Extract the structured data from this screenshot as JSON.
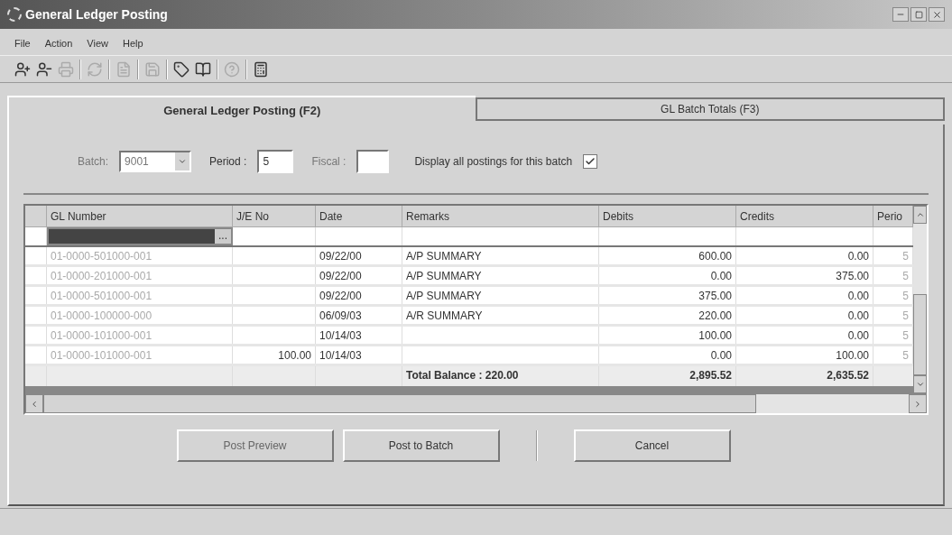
{
  "window": {
    "title": "General Ledger Posting"
  },
  "menu": [
    "File",
    "Action",
    "View",
    "Help"
  ],
  "tabs": [
    {
      "label": "General Ledger Posting (F2)",
      "selected": true
    },
    {
      "label": "GL Batch Totals (F3)",
      "selected": false
    }
  ],
  "filters": {
    "batch_label": "Batch:",
    "batch_value": "9001",
    "batch_disabled": true,
    "period_label": "Period :",
    "period_value": "5",
    "fiscal_label": "Fiscal :",
    "display_all_label": "Display all postings for this batch",
    "display_all_checked": true
  },
  "table": {
    "columns": [
      "GL Number",
      "J/E No",
      "Date",
      "Remarks",
      "Debits",
      "Credits",
      "Perio"
    ],
    "edit_button": "...",
    "rows": [
      {
        "gl": "01-0000-501000-001",
        "je": "",
        "date": "09/22/00",
        "remarks": "A/P SUMMARY",
        "debits": "600.00",
        "credits": "0.00",
        "period": "5"
      },
      {
        "gl": "01-0000-201000-001",
        "je": "",
        "date": "09/22/00",
        "remarks": "A/P SUMMARY",
        "debits": "0.00",
        "credits": "375.00",
        "period": "5"
      },
      {
        "gl": "01-0000-501000-001",
        "je": "",
        "date": "09/22/00",
        "remarks": "A/P SUMMARY",
        "debits": "375.00",
        "credits": "0.00",
        "period": "5"
      },
      {
        "gl": "01-0000-100000-000",
        "je": "",
        "date": "06/09/03",
        "remarks": "A/R SUMMARY",
        "debits": "220.00",
        "credits": "0.00",
        "period": "5"
      },
      {
        "gl": "01-0000-101000-001",
        "je": "",
        "date": "10/14/03",
        "remarks": "",
        "debits": "100.00",
        "credits": "0.00",
        "period": "5"
      },
      {
        "gl": "01-0000-101000-001",
        "je": "100.00",
        "date": "10/14/03",
        "remarks": "",
        "debits": "0.00",
        "credits": "100.00",
        "period": "5"
      }
    ],
    "total": {
      "label": "Total Balance : 220.00",
      "debits": "2,895.52",
      "credits": "2,635.52"
    }
  },
  "buttons": [
    {
      "label": "Post Preview",
      "disabled": true
    },
    {
      "label": "Post to Batch",
      "disabled": false
    },
    {
      "label": "Cancel",
      "disabled": false
    }
  ]
}
